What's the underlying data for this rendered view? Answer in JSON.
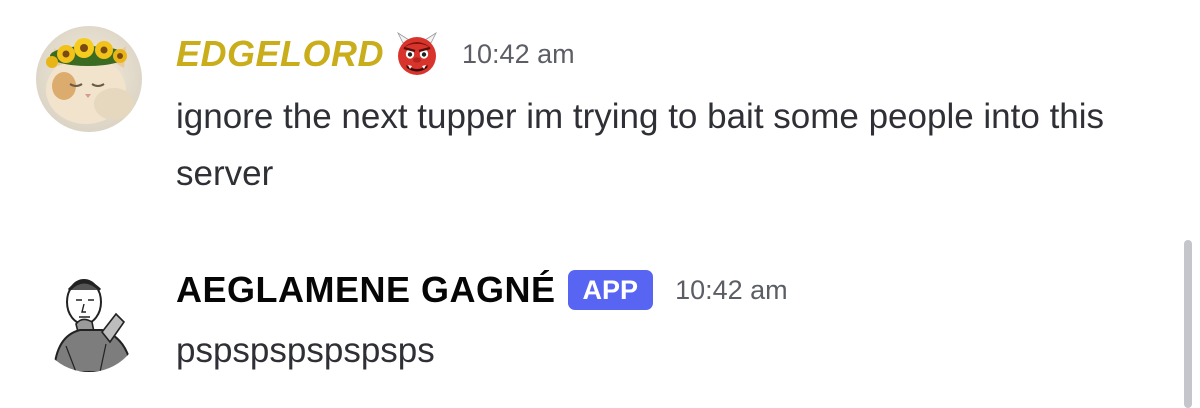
{
  "messages": [
    {
      "username": "EDGELORD",
      "username_color": "#c9ad1a",
      "emoji_icon": "ogre-face-icon",
      "timestamp": "10:42 am",
      "content": "ignore the next tupper im trying to bait some people into this server",
      "avatar_icon": "cat-with-sunflower-crown-avatar"
    },
    {
      "username": "AEGLAMENE GAGNÉ",
      "username_color": "#060607",
      "badge": "APP",
      "badge_color": "#5865f2",
      "timestamp": "10:42 am",
      "content": "pspspspspspsps",
      "avatar_icon": "sketched-man-thinking-avatar"
    }
  ]
}
